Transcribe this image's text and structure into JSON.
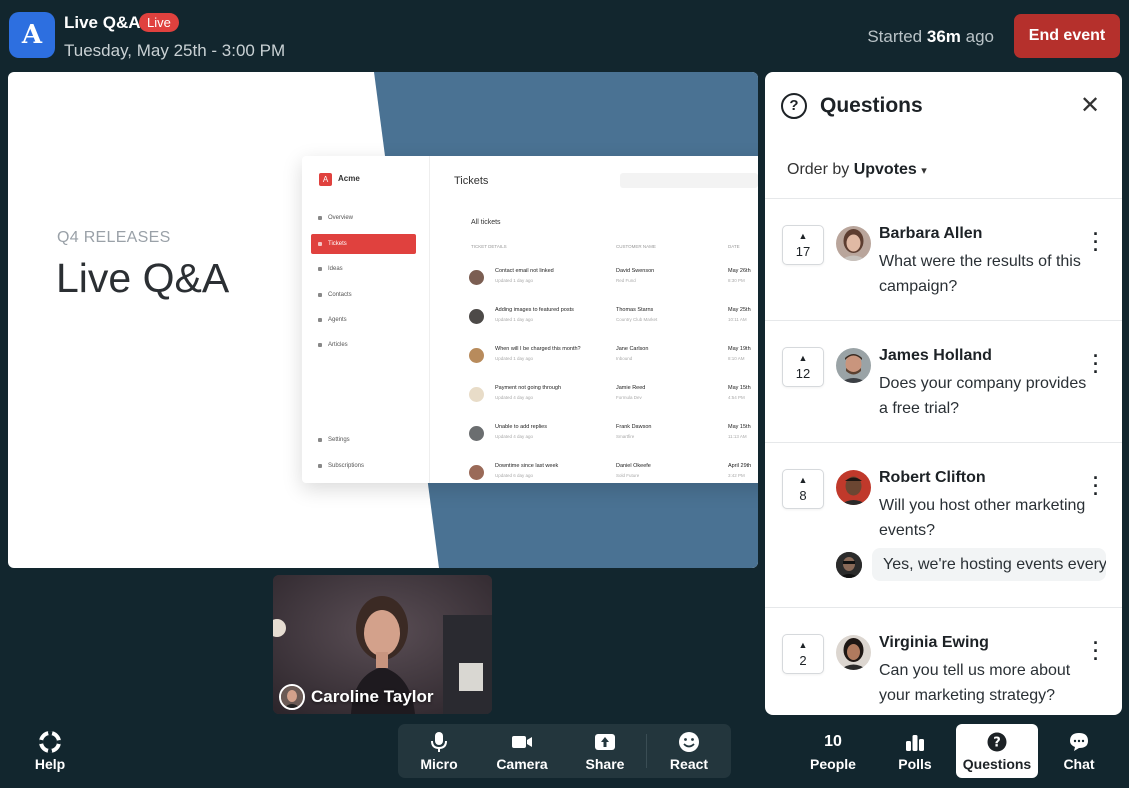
{
  "header": {
    "app_logo_letter": "A",
    "title": "Live Q&A",
    "live_badge": "Live",
    "date": "Tuesday, May 25th - 3:00 PM",
    "started_prefix": "Started",
    "started_value": "36m",
    "started_suffix": "ago",
    "end_button": "End event"
  },
  "slide": {
    "kicker": "Q4 RELEASES",
    "title": "Live Q&A",
    "accent_color": "#4a7293",
    "mock_app": {
      "brand": "Acme",
      "logo_letter": "A",
      "nav": [
        "Overview",
        "Tickets",
        "Ideas",
        "Contacts",
        "Agents",
        "Articles"
      ],
      "nav_bottom": [
        "Settings",
        "Subscriptions"
      ],
      "active_nav": "Tickets",
      "heading": "Tickets",
      "list_title": "All tickets",
      "col_ticket": "TICKET DETAILS",
      "col_customer": "CUSTOMER NAME",
      "col_date": "DATE",
      "rows": [
        {
          "subject": "Contact email not linked",
          "updated": "Updated 1 day ago",
          "customer": "David Swenson",
          "company": "Red Fund",
          "date": "May 26th",
          "time": "8:30 PM"
        },
        {
          "subject": "Adding images to featured posts",
          "updated": "Updated 1 day ago",
          "customer": "Thomas Starns",
          "company": "Country Club Market",
          "date": "May 25th",
          "time": "10:11 AM"
        },
        {
          "subject": "When will I be charged this month?",
          "updated": "Updated 1 day ago",
          "customer": "Jane Carlson",
          "company": "Inbound",
          "date": "May 19th",
          "time": "8:10 AM"
        },
        {
          "subject": "Payment not going through",
          "updated": "Updated 4 day ago",
          "customer": "Jamie Reed",
          "company": "Formula Dev",
          "date": "May 15th",
          "time": "4:54 PM"
        },
        {
          "subject": "Unable to add replies",
          "updated": "Updated 4 day ago",
          "customer": "Frank Dawson",
          "company": "Smartfire",
          "date": "May 15th",
          "time": "11:13 AM"
        },
        {
          "subject": "Downtime since last week",
          "updated": "Updated 6 day ago",
          "customer": "Daniel Okeefe",
          "company": "Sold Future",
          "date": "April 29th",
          "time": "3:42 PM"
        }
      ]
    }
  },
  "presenter": {
    "name": "Caroline Taylor"
  },
  "questions_panel": {
    "title": "Questions",
    "order_label": "Order by",
    "order_value": "Upvotes",
    "items": [
      {
        "votes": "17",
        "name": "Barbara Allen",
        "text": "What were the results of this campaign?"
      },
      {
        "votes": "12",
        "name": "James Holland",
        "text": "Does your company provides a free trial?"
      },
      {
        "votes": "8",
        "name": "Robert Clifton",
        "text": "Will you host other marketing events?",
        "reply": "Yes, we're hosting events every"
      },
      {
        "votes": "2",
        "name": "Virginia Ewing",
        "text": "Can you tell us more about your marketing strategy?"
      }
    ]
  },
  "toolbar": {
    "help": "Help",
    "micro": "Micro",
    "camera": "Camera",
    "share": "Share",
    "react": "React",
    "people_count": "10",
    "people": "People",
    "polls": "Polls",
    "questions": "Questions",
    "chat": "Chat"
  },
  "colors": {
    "background": "#12262e",
    "live_badge": "#e0413e",
    "end_button": "#b5302c",
    "logo": "#2d6fe0"
  }
}
